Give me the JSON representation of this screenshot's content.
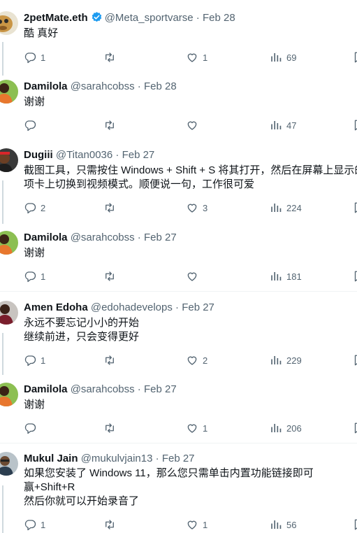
{
  "tweets": [
    {
      "name": "2petMate.eth",
      "handle": "@Meta_sportvarse",
      "date": "Feb 28",
      "verified": true,
      "lines": [
        "酷 真好"
      ],
      "counts": {
        "replies": "1",
        "retweets": "",
        "likes": "1",
        "views": "69"
      }
    },
    {
      "name": "Damilola",
      "handle": "@sarahcobss",
      "date": "Feb 28",
      "lines": [
        "谢谢"
      ],
      "counts": {
        "replies": "",
        "retweets": "",
        "likes": "",
        "views": "47"
      }
    },
    {
      "name": "Dugiii",
      "handle": "@Titan0036",
      "date": "Feb 27",
      "lines": [
        "截图工具，只需按住 Windows + Shift + S 将其打开，然后在屏幕上显示的",
        "项卡上切换到视频模式。顺便说一句，工作很可爱"
      ],
      "counts": {
        "replies": "2",
        "retweets": "",
        "likes": "3",
        "views": "224"
      }
    },
    {
      "name": "Damilola",
      "handle": "@sarahcobss",
      "date": "Feb 27",
      "lines": [
        "谢谢"
      ],
      "counts": {
        "replies": "1",
        "retweets": "",
        "likes": "",
        "views": "181"
      }
    },
    {
      "name": "Amen Edoha",
      "handle": "@edohadevelops",
      "date": "Feb 27",
      "lines": [
        "永远不要忘记小小的开始",
        "继续前进，只会变得更好"
      ],
      "counts": {
        "replies": "1",
        "retweets": "",
        "likes": "2",
        "views": "229"
      }
    },
    {
      "name": "Damilola",
      "handle": "@sarahcobss",
      "date": "Feb 27",
      "lines": [
        "谢谢"
      ],
      "counts": {
        "replies": "",
        "retweets": "",
        "likes": "1",
        "views": "206"
      }
    },
    {
      "name": "Mukul Jain",
      "handle": "@mukulvjain13",
      "date": "Feb 27",
      "lines": [
        "如果您安装了 Windows 11，那么您只需单击内置功能链接即可",
        "赢+Shift+R",
        "然后你就可以开始录音了"
      ],
      "counts": {
        "replies": "1",
        "retweets": "",
        "likes": "1",
        "views": "56"
      }
    }
  ],
  "icons": {
    "reply": "reply-icon",
    "retweet": "retweet-icon",
    "like": "like-icon",
    "views": "views-icon",
    "bookmark": "bookmark-icon",
    "verified": "verified-badge-icon"
  },
  "colors": {
    "text": "#0f1419",
    "secondary": "#536471",
    "verified": "#1d9bf0",
    "separator": "#eff3f4",
    "thread_line": "#cfd9de"
  }
}
